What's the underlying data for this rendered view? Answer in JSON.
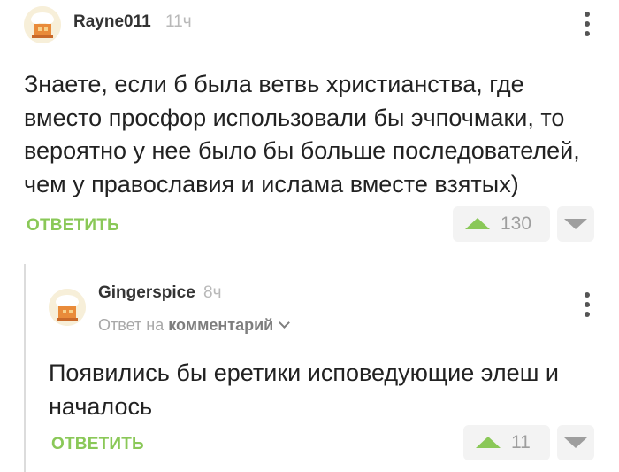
{
  "comments": [
    {
      "author": "Rayne011",
      "time": "11ч",
      "text": "Знаете, если б была ветвь христианства, где вместо просфор использовали бы эчпочмаки, то вероятно у нее было бы больше последователей, чем у православия и ислама вместе взятых)",
      "reply_label": "ОТВЕТИТЬ",
      "votes": "130"
    },
    {
      "author": "Gingerspice",
      "time": "8ч",
      "reply_prefix": "Ответ на",
      "reply_target": "комментарий",
      "text": "Появились бы еретики исповедующие элеш и началось",
      "reply_label": "ОТВЕТИТЬ",
      "votes": "11"
    }
  ],
  "colors": {
    "accent": "#8ac858",
    "muted": "#b9b9b9",
    "vote_bg": "#f3f3f3"
  },
  "icons": [
    "avatar-icon",
    "more-options-icon",
    "upvote-icon",
    "downvote-icon",
    "chevron-down-icon"
  ]
}
